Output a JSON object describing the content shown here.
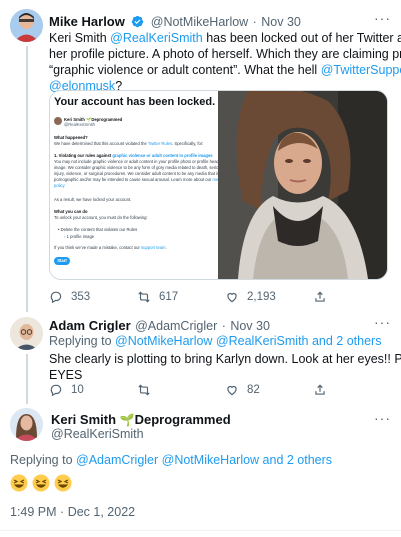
{
  "tweet1": {
    "name": "Mike Harlow",
    "handle": "@NotMikeHarlow",
    "sep": "·",
    "date": "Nov 30",
    "line1_pre": "Keri Smith ",
    "line1_link": "@RealKeriSmith",
    "line1_post": " has been locked out of her Twitter account for",
    "line2": "her profile picture. A photo of herself. Which they are claiming promotes",
    "line3_pre": "“graphic violence or adult content”. What the hell ",
    "line3_link": "@TwitterSupport",
    "line4_link": "@elonmusk",
    "line4_post": "?",
    "replies": "353",
    "retweets": "617",
    "likes": "2,193",
    "media": {
      "heading": "Your account has been locked.",
      "profile_name": "Keri Smith 🌱Deprogrammed",
      "profile_handle": "@RealKeriSmith",
      "q1": "What happened?",
      "p1_pre": "We have determined that this account violated the ",
      "p1_link": "Twitter Rules",
      "p1_post": ". Specifically, for:",
      "v_title_pre": "1. Violating our rules against ",
      "v_title_link": "graphic violence or adult content in profile images",
      "v_body1": "You may not include graphic violence or adult content in your profile photo or profile header",
      "v_body2": "image. We consider graphic violence to be any form of gory media related to death, serious",
      "v_body3": "injury, violence, or surgical procedures. We consider adult content to be any media that is",
      "v_body4": "pornographic and/or may be intended to cause sexual arousal. Learn more about our ",
      "v_body4_link": "media",
      "v_body5_link": "policy",
      "p2": "As a result, we have locked your account.",
      "q2": "What you can do",
      "p3": "To unlock your account, you must do the following:",
      "bullet1": "Delete the content that violates our Rules",
      "bullet2": "1 profile image",
      "p4_pre": "If you think we’ve made a mistake, contact our ",
      "p4_link": "support team",
      "p4_post": ".",
      "start": "Start"
    }
  },
  "tweet2": {
    "name": "Adam Crigler",
    "handle": "@AdamCrigler",
    "sep": "·",
    "date": "Nov 30",
    "replying_label": "Replying to ",
    "replying_links": "@NotMikeHarlow @RealKeriSmith",
    "replying_others": " and 2 others",
    "line1": "She clearly is plotting to bring Karlyn down.  Look at her eyes!!  PLOTTING",
    "line2": "EYES",
    "replies": "10",
    "retweets": "",
    "likes": "82"
  },
  "tweet3": {
    "name_a": "Keri Smith ",
    "name_emoji": "🌱",
    "name_b": "Deprogrammed",
    "handle": "@RealKeriSmith",
    "replying_label": "Replying to ",
    "replying_links": "@AdamCrigler @NotMikeHarlow",
    "replying_others": " and 2 others",
    "emojis": "😆😆😆",
    "time": "1:49 PM",
    "sep": "·",
    "date": "Dec 1, 2022"
  },
  "colors": {
    "link": "#1d9bf0",
    "muted": "#536471",
    "verified": "#1d9bf0",
    "thread": "#cfd9de"
  }
}
